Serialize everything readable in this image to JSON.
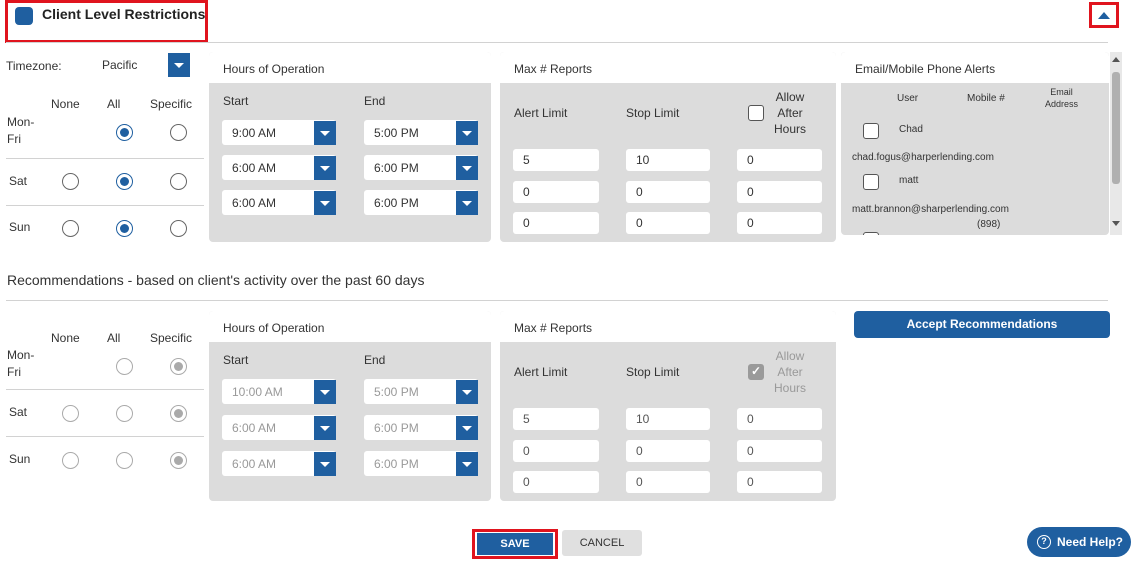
{
  "header": {
    "title": "Client Level Restrictions"
  },
  "timezone": {
    "label": "Timezone:",
    "value": "Pacific"
  },
  "days": {
    "col_none": "None",
    "col_all": "All",
    "col_specific": "Specific",
    "mon_fri_line1": "Mon-",
    "mon_fri_line2": "Fri",
    "sat": "Sat",
    "sun": "Sun"
  },
  "current": {
    "hours": {
      "title": "Hours of Operation",
      "start_label": "Start",
      "end_label": "End",
      "rows": [
        {
          "start": "9:00 AM",
          "end": "5:00 PM"
        },
        {
          "start": "6:00 AM",
          "end": "6:00 PM"
        },
        {
          "start": "6:00 AM",
          "end": "6:00 PM"
        }
      ]
    },
    "max_reports": {
      "title": "Max # Reports",
      "alert_limit": "Alert Limit",
      "stop_limit": "Stop Limit",
      "allow_line1": "Allow",
      "allow_line2": "After",
      "allow_line3": "Hours",
      "rows": [
        {
          "alert": "5",
          "stop": "10",
          "after": "0"
        },
        {
          "alert": "0",
          "stop": "0",
          "after": "0"
        },
        {
          "alert": "0",
          "stop": "0",
          "after": "0"
        }
      ]
    },
    "alerts": {
      "title": "Email/Mobile Phone Alerts",
      "col_user": "User",
      "col_mobile": "Mobile #",
      "col_email_line1": "Email",
      "col_email_line2": "Address",
      "users": [
        {
          "name": "Chad",
          "email": "chad.fogus@harperlending.com"
        },
        {
          "name": "matt",
          "email": "matt.brannon@sharperlending.com",
          "mobile": "(898)"
        }
      ]
    }
  },
  "recommendations": {
    "heading": "Recommendations - based on client's activity over the past 60 days",
    "hours": {
      "title": "Hours of Operation",
      "start_label": "Start",
      "end_label": "End",
      "rows": [
        {
          "start": "10:00 AM",
          "end": "5:00 PM"
        },
        {
          "start": "6:00 AM",
          "end": "6:00 PM"
        },
        {
          "start": "6:00 AM",
          "end": "6:00 PM"
        }
      ]
    },
    "max_reports": {
      "title": "Max # Reports",
      "alert_limit": "Alert Limit",
      "stop_limit": "Stop Limit",
      "allow_line1": "Allow",
      "allow_line2": "After",
      "allow_line3": "Hours",
      "rows": [
        {
          "alert": "5",
          "stop": "10",
          "after": "0"
        },
        {
          "alert": "0",
          "stop": "0",
          "after": "0"
        },
        {
          "alert": "0",
          "stop": "0",
          "after": "0"
        }
      ]
    },
    "accept_label": "Accept Recommendations"
  },
  "footer": {
    "save": "SAVE",
    "cancel": "CANCEL",
    "help": "Need Help?"
  }
}
